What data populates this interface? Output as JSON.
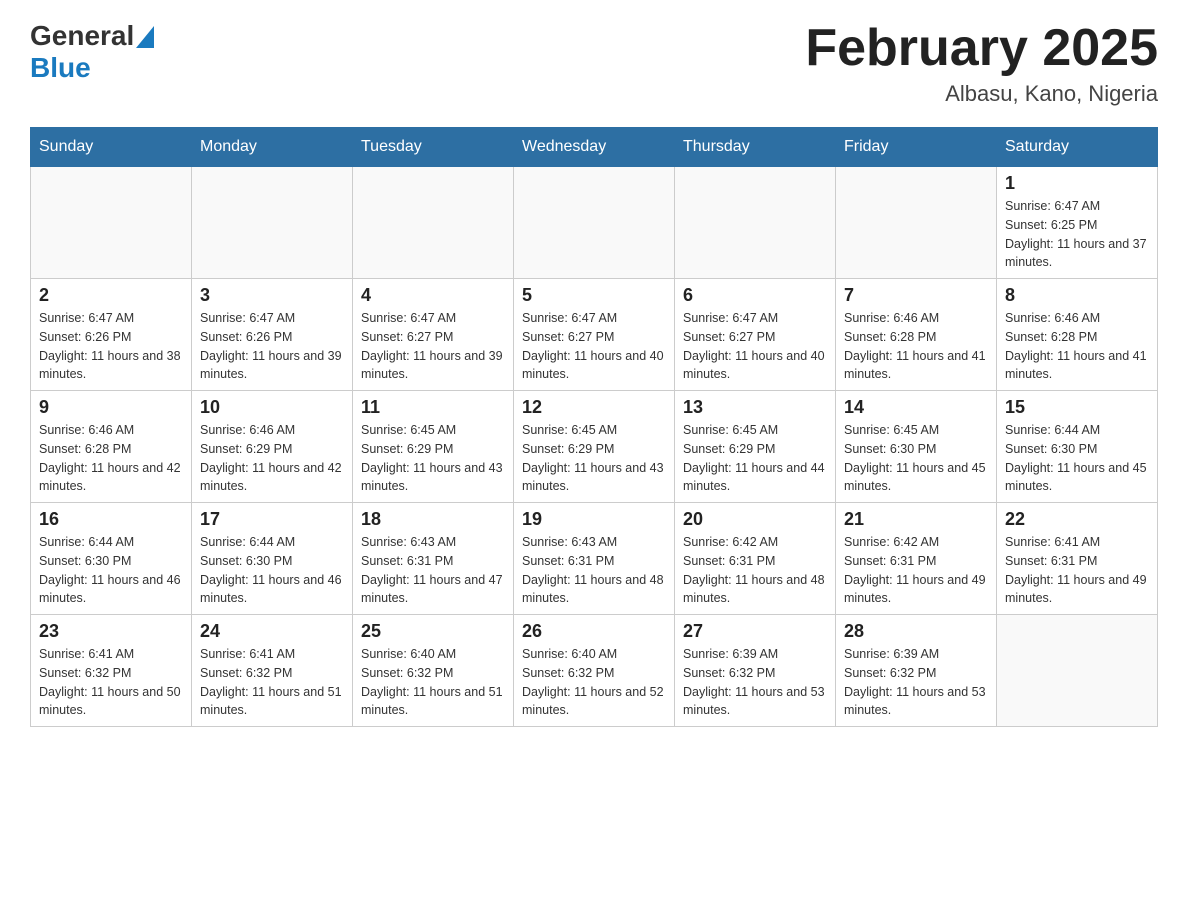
{
  "header": {
    "logo": {
      "general": "General",
      "blue": "Blue",
      "alt": "GeneralBlue logo"
    },
    "title": "February 2025",
    "location": "Albasu, Kano, Nigeria"
  },
  "weekdays": [
    "Sunday",
    "Monday",
    "Tuesday",
    "Wednesday",
    "Thursday",
    "Friday",
    "Saturday"
  ],
  "weeks": [
    [
      {
        "day": "",
        "sunrise": "",
        "sunset": "",
        "daylight": ""
      },
      {
        "day": "",
        "sunrise": "",
        "sunset": "",
        "daylight": ""
      },
      {
        "day": "",
        "sunrise": "",
        "sunset": "",
        "daylight": ""
      },
      {
        "day": "",
        "sunrise": "",
        "sunset": "",
        "daylight": ""
      },
      {
        "day": "",
        "sunrise": "",
        "sunset": "",
        "daylight": ""
      },
      {
        "day": "",
        "sunrise": "",
        "sunset": "",
        "daylight": ""
      },
      {
        "day": "1",
        "sunrise": "Sunrise: 6:47 AM",
        "sunset": "Sunset: 6:25 PM",
        "daylight": "Daylight: 11 hours and 37 minutes."
      }
    ],
    [
      {
        "day": "2",
        "sunrise": "Sunrise: 6:47 AM",
        "sunset": "Sunset: 6:26 PM",
        "daylight": "Daylight: 11 hours and 38 minutes."
      },
      {
        "day": "3",
        "sunrise": "Sunrise: 6:47 AM",
        "sunset": "Sunset: 6:26 PM",
        "daylight": "Daylight: 11 hours and 39 minutes."
      },
      {
        "day": "4",
        "sunrise": "Sunrise: 6:47 AM",
        "sunset": "Sunset: 6:27 PM",
        "daylight": "Daylight: 11 hours and 39 minutes."
      },
      {
        "day": "5",
        "sunrise": "Sunrise: 6:47 AM",
        "sunset": "Sunset: 6:27 PM",
        "daylight": "Daylight: 11 hours and 40 minutes."
      },
      {
        "day": "6",
        "sunrise": "Sunrise: 6:47 AM",
        "sunset": "Sunset: 6:27 PM",
        "daylight": "Daylight: 11 hours and 40 minutes."
      },
      {
        "day": "7",
        "sunrise": "Sunrise: 6:46 AM",
        "sunset": "Sunset: 6:28 PM",
        "daylight": "Daylight: 11 hours and 41 minutes."
      },
      {
        "day": "8",
        "sunrise": "Sunrise: 6:46 AM",
        "sunset": "Sunset: 6:28 PM",
        "daylight": "Daylight: 11 hours and 41 minutes."
      }
    ],
    [
      {
        "day": "9",
        "sunrise": "Sunrise: 6:46 AM",
        "sunset": "Sunset: 6:28 PM",
        "daylight": "Daylight: 11 hours and 42 minutes."
      },
      {
        "day": "10",
        "sunrise": "Sunrise: 6:46 AM",
        "sunset": "Sunset: 6:29 PM",
        "daylight": "Daylight: 11 hours and 42 minutes."
      },
      {
        "day": "11",
        "sunrise": "Sunrise: 6:45 AM",
        "sunset": "Sunset: 6:29 PM",
        "daylight": "Daylight: 11 hours and 43 minutes."
      },
      {
        "day": "12",
        "sunrise": "Sunrise: 6:45 AM",
        "sunset": "Sunset: 6:29 PM",
        "daylight": "Daylight: 11 hours and 43 minutes."
      },
      {
        "day": "13",
        "sunrise": "Sunrise: 6:45 AM",
        "sunset": "Sunset: 6:29 PM",
        "daylight": "Daylight: 11 hours and 44 minutes."
      },
      {
        "day": "14",
        "sunrise": "Sunrise: 6:45 AM",
        "sunset": "Sunset: 6:30 PM",
        "daylight": "Daylight: 11 hours and 45 minutes."
      },
      {
        "day": "15",
        "sunrise": "Sunrise: 6:44 AM",
        "sunset": "Sunset: 6:30 PM",
        "daylight": "Daylight: 11 hours and 45 minutes."
      }
    ],
    [
      {
        "day": "16",
        "sunrise": "Sunrise: 6:44 AM",
        "sunset": "Sunset: 6:30 PM",
        "daylight": "Daylight: 11 hours and 46 minutes."
      },
      {
        "day": "17",
        "sunrise": "Sunrise: 6:44 AM",
        "sunset": "Sunset: 6:30 PM",
        "daylight": "Daylight: 11 hours and 46 minutes."
      },
      {
        "day": "18",
        "sunrise": "Sunrise: 6:43 AM",
        "sunset": "Sunset: 6:31 PM",
        "daylight": "Daylight: 11 hours and 47 minutes."
      },
      {
        "day": "19",
        "sunrise": "Sunrise: 6:43 AM",
        "sunset": "Sunset: 6:31 PM",
        "daylight": "Daylight: 11 hours and 48 minutes."
      },
      {
        "day": "20",
        "sunrise": "Sunrise: 6:42 AM",
        "sunset": "Sunset: 6:31 PM",
        "daylight": "Daylight: 11 hours and 48 minutes."
      },
      {
        "day": "21",
        "sunrise": "Sunrise: 6:42 AM",
        "sunset": "Sunset: 6:31 PM",
        "daylight": "Daylight: 11 hours and 49 minutes."
      },
      {
        "day": "22",
        "sunrise": "Sunrise: 6:41 AM",
        "sunset": "Sunset: 6:31 PM",
        "daylight": "Daylight: 11 hours and 49 minutes."
      }
    ],
    [
      {
        "day": "23",
        "sunrise": "Sunrise: 6:41 AM",
        "sunset": "Sunset: 6:32 PM",
        "daylight": "Daylight: 11 hours and 50 minutes."
      },
      {
        "day": "24",
        "sunrise": "Sunrise: 6:41 AM",
        "sunset": "Sunset: 6:32 PM",
        "daylight": "Daylight: 11 hours and 51 minutes."
      },
      {
        "day": "25",
        "sunrise": "Sunrise: 6:40 AM",
        "sunset": "Sunset: 6:32 PM",
        "daylight": "Daylight: 11 hours and 51 minutes."
      },
      {
        "day": "26",
        "sunrise": "Sunrise: 6:40 AM",
        "sunset": "Sunset: 6:32 PM",
        "daylight": "Daylight: 11 hours and 52 minutes."
      },
      {
        "day": "27",
        "sunrise": "Sunrise: 6:39 AM",
        "sunset": "Sunset: 6:32 PM",
        "daylight": "Daylight: 11 hours and 53 minutes."
      },
      {
        "day": "28",
        "sunrise": "Sunrise: 6:39 AM",
        "sunset": "Sunset: 6:32 PM",
        "daylight": "Daylight: 11 hours and 53 minutes."
      },
      {
        "day": "",
        "sunrise": "",
        "sunset": "",
        "daylight": ""
      }
    ]
  ]
}
